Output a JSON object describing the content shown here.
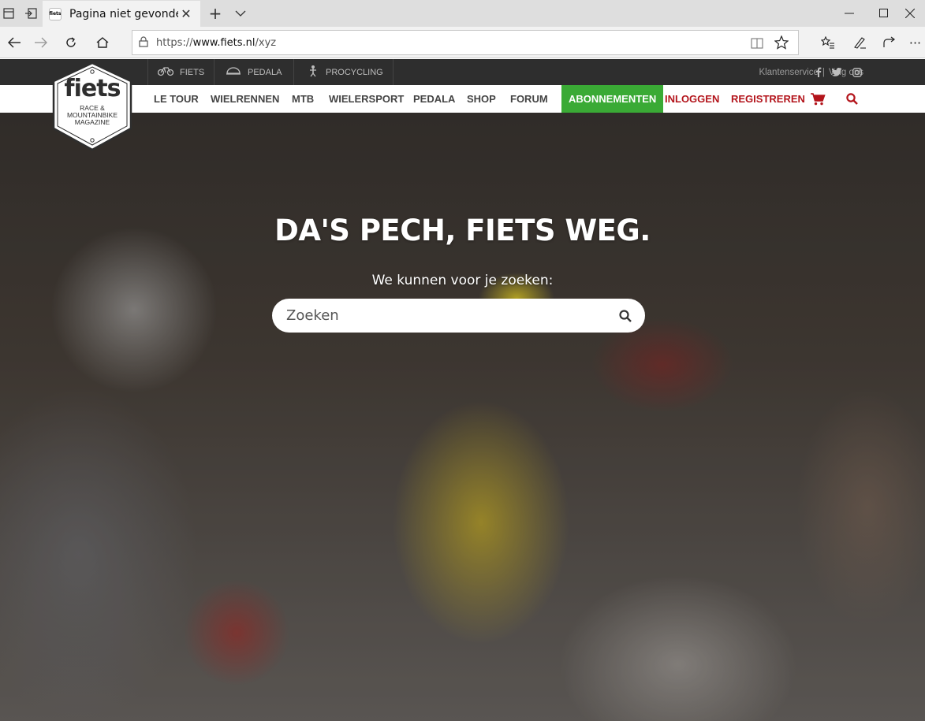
{
  "browser": {
    "tab_title": "Pagina niet gevonden |",
    "tab_favicon_text": "fiets",
    "url_prefix": "https://",
    "url_host": "www.fiets.nl",
    "url_path": "/xyz"
  },
  "topbar": {
    "brands": [
      {
        "label": "FIETS",
        "icon": "bicycle-icon"
      },
      {
        "label": "PEDALA",
        "icon": "helmet-icon"
      },
      {
        "label": "PROCYCLING",
        "icon": "cyclist-icon"
      }
    ],
    "klantenservice": "Klantenservice",
    "separator": "|",
    "volg_ons": "Volg ons",
    "social": {
      "facebook": "f",
      "twitter": "t",
      "instagram": "ig"
    }
  },
  "logo": {
    "name": "fiets",
    "tagline_1": "RACE &",
    "tagline_2": "MOUNTAINBIKE",
    "tagline_3": "MAGAZINE"
  },
  "nav": {
    "items": [
      "LE TOUR",
      "WIELRENNEN",
      "MTB",
      "WIELERSPORT",
      "PEDALA",
      "SHOP",
      "FORUM"
    ],
    "abonnementen": "ABONNEMENTEN",
    "inloggen": "INLOGGEN",
    "registreren": "REGISTREREN"
  },
  "hero": {
    "title": "DA'S PECH, FIETS WEG.",
    "subtitle": "We kunnen voor je zoeken:",
    "search_placeholder": "Zoeken"
  },
  "colors": {
    "accent_green": "#3aaa35",
    "accent_red": "#b3141b",
    "topbar_bg": "#2e2e2e"
  }
}
